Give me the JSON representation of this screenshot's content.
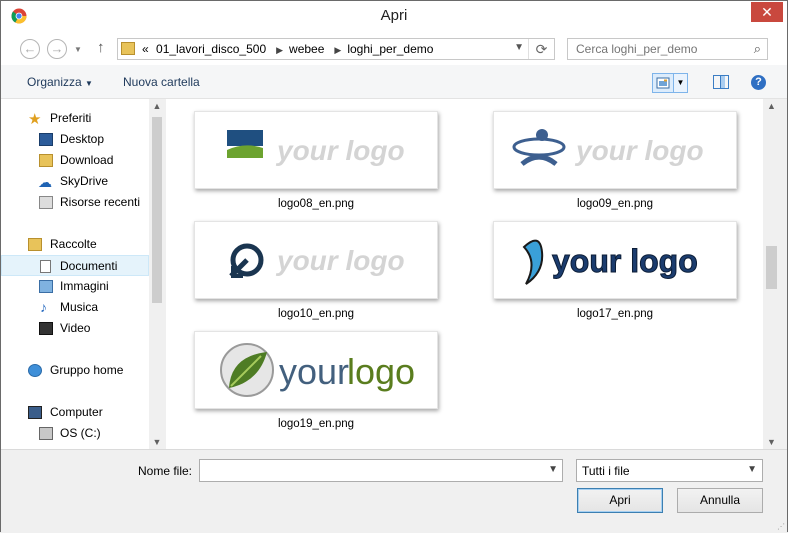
{
  "window": {
    "title": "Apri",
    "close": "✕"
  },
  "nav": {
    "back": "←",
    "forward": "→",
    "up": "↑",
    "crumbs_overflow": "«",
    "crumbs": [
      "01_lavori_disco_500",
      "webee",
      "loghi_per_demo"
    ],
    "search_placeholder": "Cerca loghi_per_demo"
  },
  "toolbar": {
    "organize": "Organizza",
    "new_folder": "Nuova cartella",
    "help": "?"
  },
  "sidebar": {
    "favorites_header": "Preferiti",
    "favorites": [
      "Desktop",
      "Download",
      "SkyDrive",
      "Risorse recenti"
    ],
    "libraries_header": "Raccolte",
    "libraries": [
      "Documenti",
      "Immagini",
      "Musica",
      "Video"
    ],
    "homegroup": "Gruppo home",
    "computer_header": "Computer",
    "drives": [
      "OS (C:)"
    ]
  },
  "files": [
    {
      "name": "logo08_en.png",
      "logo_text": "your logo"
    },
    {
      "name": "logo09_en.png",
      "logo_text": "your logo"
    },
    {
      "name": "logo10_en.png",
      "logo_text": "your logo"
    },
    {
      "name": "logo17_en.png",
      "logo_text": "your logo"
    },
    {
      "name": "logo19_en.png",
      "logo_text_a": "your",
      "logo_text_b": "logo"
    }
  ],
  "bottom": {
    "filename_label": "Nome file:",
    "filename_value": "",
    "filetype": "Tutti i file",
    "open": "Apri",
    "cancel": "Annulla"
  },
  "colors": {
    "accent": "#2f6fc3",
    "selection": "#e5f3fb",
    "close": "#c9483e"
  }
}
